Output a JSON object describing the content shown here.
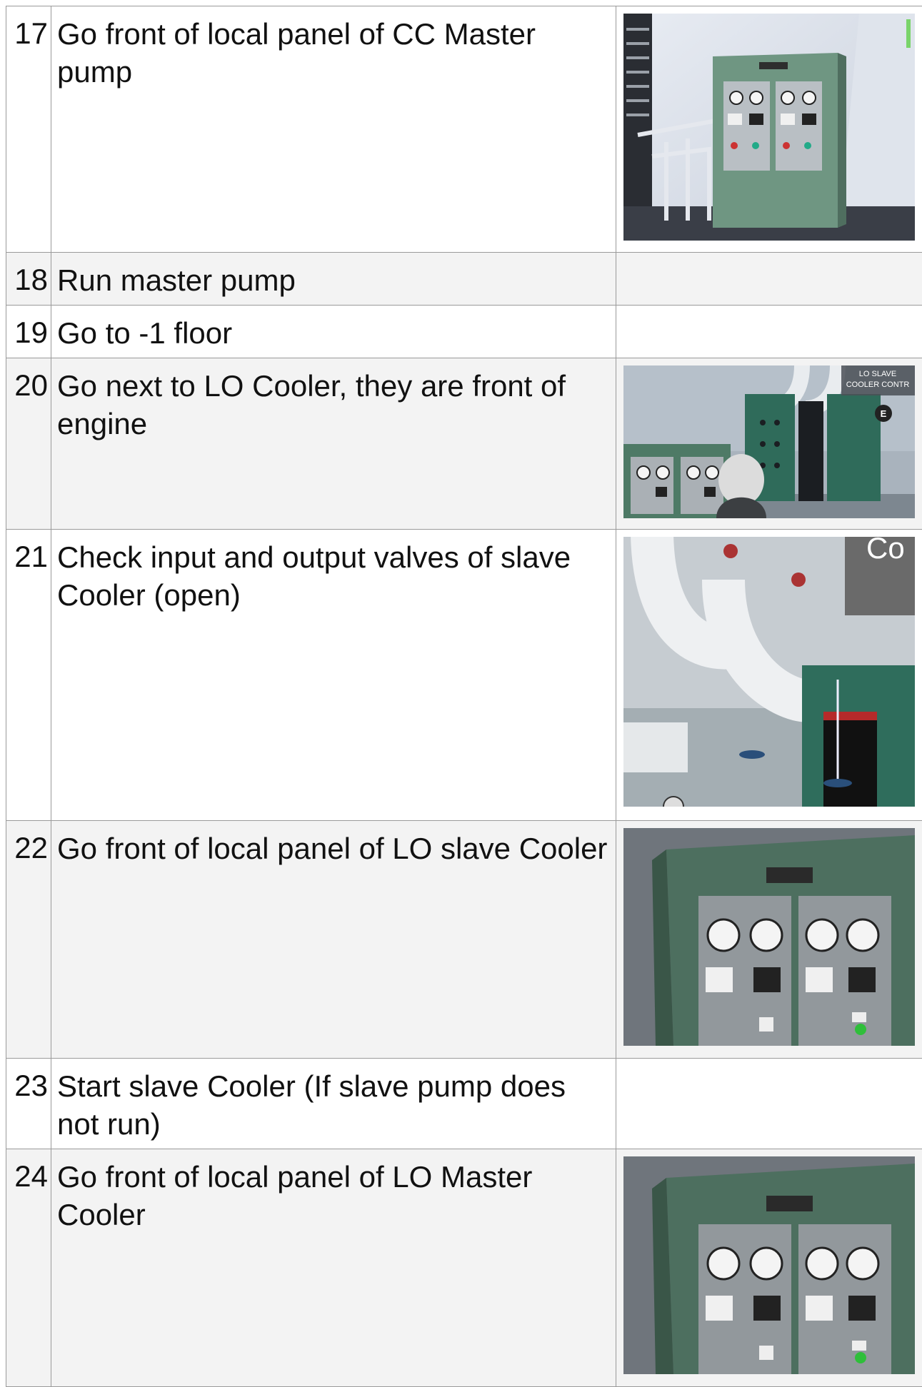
{
  "rows": [
    {
      "num": "17",
      "text": "Go front of local panel of CC Master pump",
      "has_image": true,
      "image_desc_icon": "cc-master-pump-panel-image"
    },
    {
      "num": "18",
      "text": "Run master pump",
      "has_image": false
    },
    {
      "num": "19",
      "text": "Go to -1 floor",
      "has_image": false
    },
    {
      "num": "20",
      "text": "Go next to LO Cooler, they are front of engine",
      "has_image": true,
      "image_desc_icon": "lo-cooler-scene-image",
      "overlay_label_1": "LO SLAVE",
      "overlay_label_2": "COOLER CONTR",
      "key_hint": "E"
    },
    {
      "num": "21",
      "text": "Check  input and output  valves  of slave Cooler (open)",
      "has_image": true,
      "image_desc_icon": "slave-cooler-valves-image",
      "overlay_fragment": "Co"
    },
    {
      "num": "22",
      "text": "Go front of local panel of LO slave Cooler",
      "has_image": true,
      "image_desc_icon": "lo-cooler-local-panel-image"
    },
    {
      "num": "23",
      "text": "Start slave Cooler (If slave pump does not run)",
      "has_image": false
    },
    {
      "num": "24",
      "text": "Go front of local panel of LO Master Cooler",
      "has_image": true,
      "image_desc_icon": "lo-cooler-local-panel-image"
    }
  ],
  "colors": {
    "border": "#9a9a9a",
    "row_shade": "#f3f3f3",
    "panel_green": "#5f8a76",
    "panel_grey": "#8c9094"
  }
}
